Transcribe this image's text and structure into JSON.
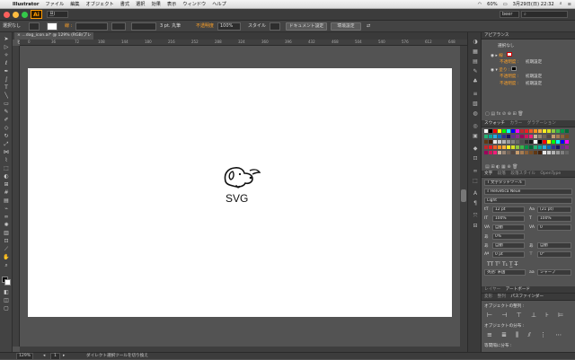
{
  "menubar": {
    "app_name": "Illustrator",
    "items": [
      "ファイル",
      "編集",
      "オブジェクト",
      "書式",
      "選択",
      "効果",
      "表示",
      "ウィンドウ",
      "ヘルプ"
    ],
    "battery": "60%",
    "clock": "3月29日(日) 22:32"
  },
  "appbar": {
    "logo": "Ai",
    "workspace_chip": "旦l",
    "user": "beer",
    "search_placeholder": ""
  },
  "control_bar": {
    "selection_label": "選択なし",
    "stroke_label": "線 :",
    "stroke_weight": "3 pt. 丸筆",
    "opacity_label": "不透明度",
    "opacity_value": "100%",
    "style_label": "スタイル",
    "doc_setup_button": "ドキュメント設定",
    "prefs_button": "環境設定"
  },
  "document": {
    "tab_title": "...dog_icon.ai* @ 129% (RGB/プレビュー)",
    "ruler_numbers": [
      "0",
      "36",
      "72",
      "108",
      "144",
      "180",
      "216",
      "252",
      "288",
      "324",
      "360",
      "396",
      "432",
      "468",
      "504",
      "540",
      "576",
      "612",
      "648",
      "684"
    ],
    "art_text": "SVG",
    "zoom": "129%",
    "artboard_number": "1",
    "status_text": "ダイレクト選択ツールを切り換え"
  },
  "appearance_panel": {
    "tab": "アピアランス",
    "title": "選択なし",
    "rows": [
      {
        "label": "線 :",
        "value": ""
      },
      {
        "label": "不透明度 :",
        "value": "初期設定"
      },
      {
        "label": "塗り :",
        "value": ""
      },
      {
        "label": "不透明度 :",
        "value": "初期設定"
      },
      {
        "label": "不透明度 :",
        "value": "初期設定"
      }
    ]
  },
  "swatches_panel": {
    "tabs": [
      "スウォッチ",
      "カラー",
      "グラデーション"
    ]
  },
  "character_panel": {
    "tabs": [
      "文字",
      "段落",
      "段落スタイル",
      "OpenType"
    ],
    "touch_type_button": "文字タッチツール",
    "font_family": "Helvetica Neue",
    "font_style": "Light",
    "font_size": "12 pt",
    "leading": "(21 pt)",
    "h_scale": "100%",
    "v_scale": "100%",
    "baseline_shift": "0%",
    "tracking": "0",
    "rotation": "0°",
    "auto_label": "自動",
    "mojikumi": "自動",
    "lang": "英語: 米国",
    "aa": "シャープ",
    "zero_pt": "0 pt"
  },
  "layers_tabs": [
    "レイヤー",
    "アートボード"
  ],
  "pathfinder_panel": {
    "tab": "パスファインダー",
    "align_label": "オブジェクトの整列 :",
    "distribute_label": "オブジェクトの分布 :",
    "spacing_label": "等間隔に分布 :"
  },
  "colors": {
    "accent": "#ffa227",
    "panel_bg": "#535353",
    "artboard": "#ffffff"
  }
}
